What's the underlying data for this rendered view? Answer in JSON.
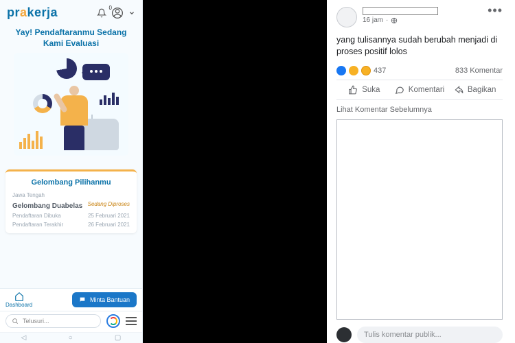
{
  "app": {
    "brand_pre": "pr",
    "brand_mid": "a",
    "brand_post": "kerja",
    "notif_count": "0",
    "hero_title": "Yay! Pendaftaranmu Sedang Kami Evaluasi"
  },
  "wave": {
    "section_title": "Gelombang Pilihanmu",
    "province": "Jawa Tengah",
    "name": "Gelombang Duabelas",
    "status": "Sedang Diproses",
    "open_label": "Pendaftaran Dibuka",
    "open_value": "25 Februari 2021",
    "close_label": "Pendaftaran Terakhir",
    "close_value": "26 Februari 2021"
  },
  "nav": {
    "dashboard": "Dashboard",
    "help_button": "Minta Bantuan"
  },
  "browser": {
    "search_placeholder": "Telusuri..."
  },
  "post": {
    "timestamp": "16 jam",
    "body": "yang tulisannya sudah berubah menjadi di proses positif lolos",
    "reaction_count": "437",
    "comment_count_label": "833 Komentar",
    "like_label": "Suka",
    "comment_label": "Komentari",
    "share_label": "Bagikan",
    "prev_comments": "Lihat Komentar Sebelumnya",
    "write_placeholder": "Tulis komentar publik..."
  }
}
